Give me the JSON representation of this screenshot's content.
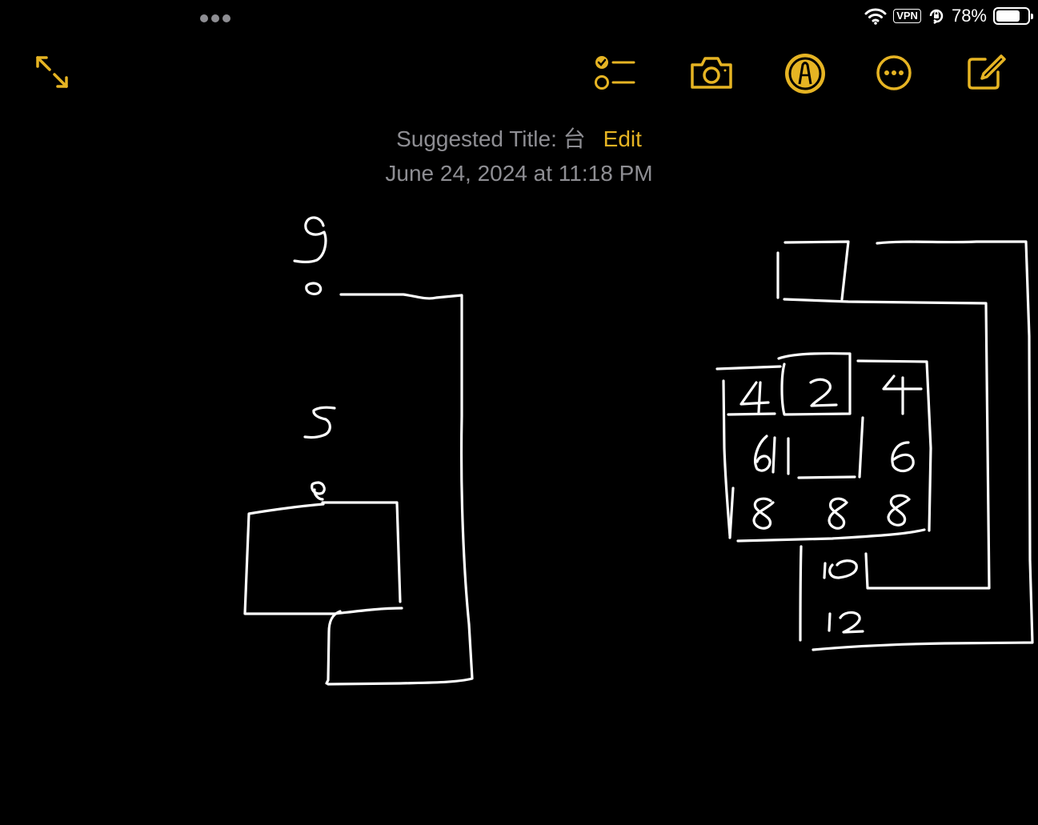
{
  "status": {
    "battery_percent": "78%",
    "battery_level": 0.78,
    "vpn_label": "VPN"
  },
  "toolbar": {
    "icons": [
      "expand-icon",
      "checklist-icon",
      "camera-icon",
      "markup-pen-icon",
      "more-icon",
      "compose-icon"
    ]
  },
  "note": {
    "suggested_label": "Suggested Title: 台",
    "edit_label": "Edit",
    "date": "June 24, 2024 at 11:18 PM"
  },
  "drawing": {
    "left_labels": [
      "9",
      "5"
    ],
    "right_labels": [
      "4",
      "2",
      "4",
      "6",
      "6",
      "8",
      "8",
      "8",
      "10",
      "12"
    ]
  },
  "colors": {
    "accent": "#e6b423",
    "background": "#000000",
    "secondary_text": "#8e8e93",
    "ink": "#ffffff"
  }
}
